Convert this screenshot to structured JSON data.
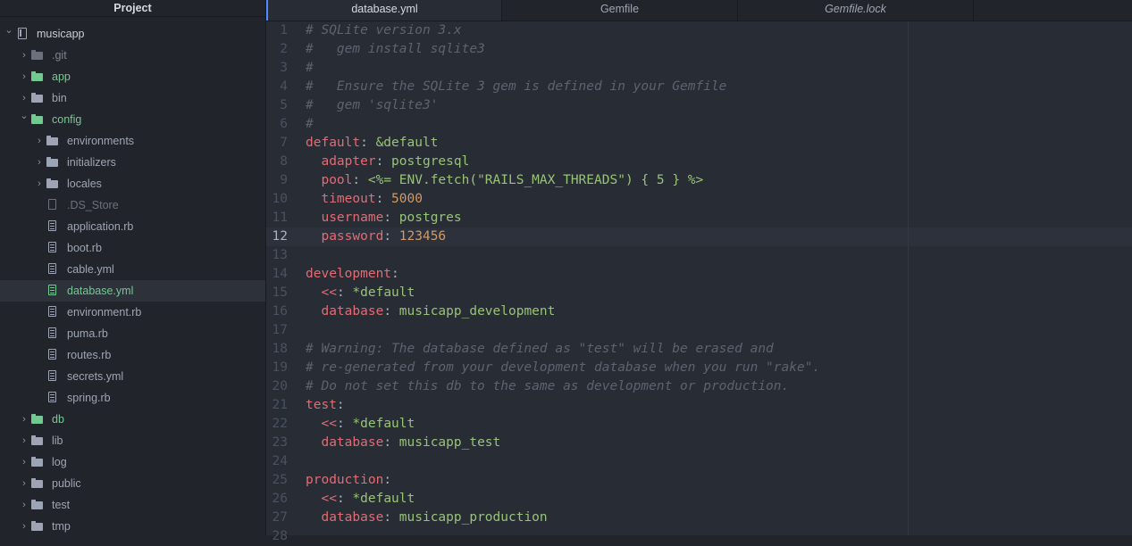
{
  "sidebar": {
    "title": "Project",
    "items": [
      {
        "label": "musicapp",
        "kind": "repo",
        "depth": 0,
        "chevron": "down",
        "color": "#c8ccd4",
        "icon": "repo-icon"
      },
      {
        "label": ".git",
        "kind": "folder",
        "depth": 1,
        "chevron": "right",
        "color": "#7d838d",
        "icon": "folder-icon"
      },
      {
        "label": "app",
        "kind": "folder",
        "depth": 1,
        "chevron": "right",
        "color": "#73c990",
        "icon": "folder-icon"
      },
      {
        "label": "bin",
        "kind": "folder",
        "depth": 1,
        "chevron": "right",
        "color": "#9da5b4",
        "icon": "folder-icon"
      },
      {
        "label": "config",
        "kind": "folder",
        "depth": 1,
        "chevron": "down",
        "color": "#73c990",
        "icon": "folder-icon"
      },
      {
        "label": "environments",
        "kind": "folder",
        "depth": 2,
        "chevron": "right",
        "color": "#9da5b4",
        "icon": "folder-icon"
      },
      {
        "label": "initializers",
        "kind": "folder",
        "depth": 2,
        "chevron": "right",
        "color": "#9da5b4",
        "icon": "folder-icon"
      },
      {
        "label": "locales",
        "kind": "folder",
        "depth": 2,
        "chevron": "right",
        "color": "#9da5b4",
        "icon": "folder-icon"
      },
      {
        "label": ".DS_Store",
        "kind": "file",
        "depth": 2,
        "color": "#6b717c",
        "icon": "file-icon"
      },
      {
        "label": "application.rb",
        "kind": "file",
        "depth": 2,
        "color": "#9da5b4",
        "icon": "file-text-icon"
      },
      {
        "label": "boot.rb",
        "kind": "file",
        "depth": 2,
        "color": "#9da5b4",
        "icon": "file-text-icon"
      },
      {
        "label": "cable.yml",
        "kind": "file",
        "depth": 2,
        "color": "#9da5b4",
        "icon": "file-text-icon"
      },
      {
        "label": "database.yml",
        "kind": "file",
        "depth": 2,
        "color": "#73c990",
        "icon": "file-text-icon",
        "selected": true
      },
      {
        "label": "environment.rb",
        "kind": "file",
        "depth": 2,
        "color": "#9da5b4",
        "icon": "file-text-icon"
      },
      {
        "label": "puma.rb",
        "kind": "file",
        "depth": 2,
        "color": "#9da5b4",
        "icon": "file-text-icon"
      },
      {
        "label": "routes.rb",
        "kind": "file",
        "depth": 2,
        "color": "#9da5b4",
        "icon": "file-text-icon"
      },
      {
        "label": "secrets.yml",
        "kind": "file",
        "depth": 2,
        "color": "#9da5b4",
        "icon": "file-text-icon"
      },
      {
        "label": "spring.rb",
        "kind": "file",
        "depth": 2,
        "color": "#9da5b4",
        "icon": "file-text-icon"
      },
      {
        "label": "db",
        "kind": "folder",
        "depth": 1,
        "chevron": "right",
        "color": "#73c990",
        "icon": "folder-icon"
      },
      {
        "label": "lib",
        "kind": "folder",
        "depth": 1,
        "chevron": "right",
        "color": "#9da5b4",
        "icon": "folder-icon"
      },
      {
        "label": "log",
        "kind": "folder",
        "depth": 1,
        "chevron": "right",
        "color": "#9da5b4",
        "icon": "folder-icon"
      },
      {
        "label": "public",
        "kind": "folder",
        "depth": 1,
        "chevron": "right",
        "color": "#9da5b4",
        "icon": "folder-icon"
      },
      {
        "label": "test",
        "kind": "folder",
        "depth": 1,
        "chevron": "right",
        "color": "#9da5b4",
        "icon": "folder-icon"
      },
      {
        "label": "tmp",
        "kind": "folder",
        "depth": 1,
        "chevron": "right",
        "color": "#9da5b4",
        "icon": "folder-icon"
      }
    ]
  },
  "tabs": [
    {
      "label": "database.yml",
      "active": true,
      "italic": false
    },
    {
      "label": "Gemfile",
      "active": false,
      "italic": false
    },
    {
      "label": "Gemfile.lock",
      "active": false,
      "italic": true
    }
  ],
  "editor": {
    "cursor_line": 12,
    "lines": [
      {
        "n": "1",
        "tokens": [
          [
            "com",
            "# SQLite version 3.x"
          ]
        ]
      },
      {
        "n": "2",
        "tokens": [
          [
            "com",
            "#   gem install sqlite3"
          ]
        ]
      },
      {
        "n": "3",
        "tokens": [
          [
            "com",
            "#"
          ]
        ]
      },
      {
        "n": "4",
        "tokens": [
          [
            "com",
            "#   Ensure the SQLite 3 gem is defined in your Gemfile"
          ]
        ]
      },
      {
        "n": "5",
        "tokens": [
          [
            "com",
            "#   gem 'sqlite3'"
          ]
        ]
      },
      {
        "n": "6",
        "tokens": [
          [
            "com",
            "#"
          ]
        ]
      },
      {
        "n": "7",
        "tokens": [
          [
            "key",
            "default"
          ],
          [
            "pun",
            ": "
          ],
          [
            "str",
            "&default"
          ]
        ]
      },
      {
        "n": "8",
        "tokens": [
          [
            "pun",
            "  "
          ],
          [
            "key",
            "adapter"
          ],
          [
            "pun",
            ": "
          ],
          [
            "str",
            "postgresql"
          ]
        ]
      },
      {
        "n": "9",
        "tokens": [
          [
            "pun",
            "  "
          ],
          [
            "key",
            "pool"
          ],
          [
            "pun",
            ": "
          ],
          [
            "str",
            "<%= ENV.fetch(\"RAILS_MAX_THREADS\") { 5 } %>"
          ]
        ]
      },
      {
        "n": "10",
        "tokens": [
          [
            "pun",
            "  "
          ],
          [
            "key",
            "timeout"
          ],
          [
            "pun",
            ": "
          ],
          [
            "num",
            "5000"
          ]
        ]
      },
      {
        "n": "11",
        "tokens": [
          [
            "pun",
            "  "
          ],
          [
            "key",
            "username"
          ],
          [
            "pun",
            ": "
          ],
          [
            "str",
            "postgres"
          ]
        ]
      },
      {
        "n": "12",
        "tokens": [
          [
            "pun",
            "  "
          ],
          [
            "key",
            "password"
          ],
          [
            "pun",
            ": "
          ],
          [
            "num",
            "123456"
          ]
        ]
      },
      {
        "n": "13",
        "tokens": []
      },
      {
        "n": "14",
        "tokens": [
          [
            "key",
            "development"
          ],
          [
            "pun",
            ":"
          ]
        ]
      },
      {
        "n": "15",
        "tokens": [
          [
            "pun",
            "  "
          ],
          [
            "key",
            "<<"
          ],
          [
            "pun",
            ": "
          ],
          [
            "str",
            "*default"
          ]
        ]
      },
      {
        "n": "16",
        "tokens": [
          [
            "pun",
            "  "
          ],
          [
            "key",
            "database"
          ],
          [
            "pun",
            ": "
          ],
          [
            "str",
            "musicapp_development"
          ]
        ]
      },
      {
        "n": "17",
        "tokens": []
      },
      {
        "n": "18",
        "tokens": [
          [
            "com",
            "# Warning: The database defined as \"test\" will be erased and"
          ]
        ]
      },
      {
        "n": "19",
        "tokens": [
          [
            "com",
            "# re-generated from your development database when you run \"rake\"."
          ]
        ]
      },
      {
        "n": "20",
        "tokens": [
          [
            "com",
            "# Do not set this db to the same as development or production."
          ]
        ]
      },
      {
        "n": "21",
        "tokens": [
          [
            "key",
            "test"
          ],
          [
            "pun",
            ":"
          ]
        ]
      },
      {
        "n": "22",
        "tokens": [
          [
            "pun",
            "  "
          ],
          [
            "key",
            "<<"
          ],
          [
            "pun",
            ": "
          ],
          [
            "str",
            "*default"
          ]
        ]
      },
      {
        "n": "23",
        "tokens": [
          [
            "pun",
            "  "
          ],
          [
            "key",
            "database"
          ],
          [
            "pun",
            ": "
          ],
          [
            "str",
            "musicapp_test"
          ]
        ]
      },
      {
        "n": "24",
        "tokens": []
      },
      {
        "n": "25",
        "tokens": [
          [
            "key",
            "production"
          ],
          [
            "pun",
            ":"
          ]
        ]
      },
      {
        "n": "26",
        "tokens": [
          [
            "pun",
            "  "
          ],
          [
            "key",
            "<<"
          ],
          [
            "pun",
            ": "
          ],
          [
            "str",
            "*default"
          ]
        ]
      },
      {
        "n": "27",
        "tokens": [
          [
            "pun",
            "  "
          ],
          [
            "key",
            "database"
          ],
          [
            "pun",
            ": "
          ],
          [
            "str",
            "musicapp_production"
          ]
        ]
      },
      {
        "n": "28",
        "tokens": []
      }
    ]
  }
}
